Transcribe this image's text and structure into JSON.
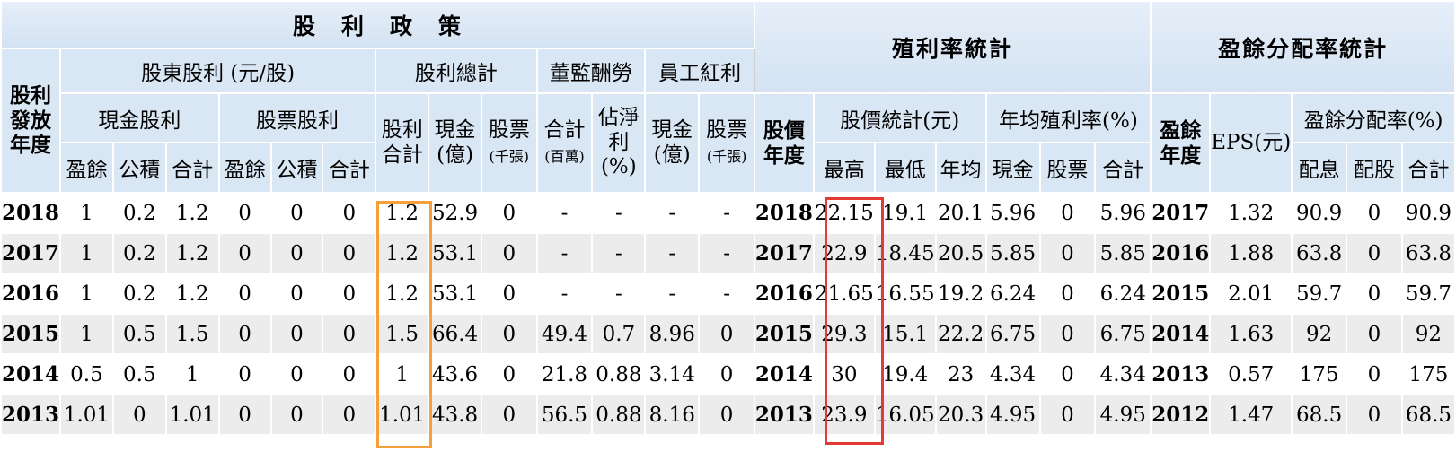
{
  "headers": {
    "dividend_policy": "股　利　政　策",
    "yield_stats": "殖利率統計",
    "payout_stats": "盈餘分配率統計",
    "dividend_year": "股利發放年度",
    "shareholder_dividend": "股東股利 (元/股)",
    "total_dividend": "股利總計",
    "director_comp": "董監酬勞",
    "employee_bonus": "員工紅利",
    "cash_dividend": "現金股利",
    "stock_dividend": "股票股利",
    "dividend_sum": "股利合計",
    "cash_100m": "現金(億)",
    "stock": "股票",
    "stock_unit": "(千張)",
    "total": "合計",
    "million_unit": "(百萬)",
    "est_net_profit": "佔淨利(%)",
    "emp_cash": "現金(億)",
    "emp_stock": "股票",
    "emp_stock_unit": "(千張)",
    "earnings": "盈餘",
    "capital_reserve": "公積",
    "subtotal": "合計",
    "price_year": "股價年度",
    "price_stats": "股價統計(元)",
    "avg_yield": "年均殖利率(%)",
    "high": "最高",
    "low": "最低",
    "avg": "年均",
    "cash": "現金",
    "stock_short": "股票",
    "sum": "合計",
    "earnings_year": "盈餘年度",
    "eps": "EPS(元)",
    "payout_ratio": "盈餘分配率(%)",
    "cash_payout": "配息",
    "stock_payout": "配股",
    "payout_total": "合計"
  },
  "rows": [
    {
      "year": "2018",
      "c_earn": "1",
      "c_res": "0.2",
      "c_tot": "1.2",
      "s_earn": "0",
      "s_res": "0",
      "s_tot": "0",
      "div_tot": "1.2",
      "cash_amt": "52.9",
      "stock_amt": "0",
      "dir_tot": "-",
      "dir_pct": "-",
      "emp_cash": "-",
      "emp_stock": "-",
      "p_year": "2018",
      "high": "22.15",
      "low": "19.1",
      "avg": "20.1",
      "y_cash": "5.96",
      "y_stock": "0",
      "y_tot": "5.96",
      "e_year": "2017",
      "eps": "1.32",
      "r_cash": "90.9",
      "r_stock": "0",
      "r_tot": "90.9"
    },
    {
      "year": "2017",
      "c_earn": "1",
      "c_res": "0.2",
      "c_tot": "1.2",
      "s_earn": "0",
      "s_res": "0",
      "s_tot": "0",
      "div_tot": "1.2",
      "cash_amt": "53.1",
      "stock_amt": "0",
      "dir_tot": "-",
      "dir_pct": "-",
      "emp_cash": "-",
      "emp_stock": "-",
      "p_year": "2017",
      "high": "22.9",
      "low": "18.45",
      "avg": "20.5",
      "y_cash": "5.85",
      "y_stock": "0",
      "y_tot": "5.85",
      "e_year": "2016",
      "eps": "1.88",
      "r_cash": "63.8",
      "r_stock": "0",
      "r_tot": "63.8"
    },
    {
      "year": "2016",
      "c_earn": "1",
      "c_res": "0.2",
      "c_tot": "1.2",
      "s_earn": "0",
      "s_res": "0",
      "s_tot": "0",
      "div_tot": "1.2",
      "cash_amt": "53.1",
      "stock_amt": "0",
      "dir_tot": "-",
      "dir_pct": "-",
      "emp_cash": "-",
      "emp_stock": "-",
      "p_year": "2016",
      "high": "21.65",
      "low": "16.55",
      "avg": "19.2",
      "y_cash": "6.24",
      "y_stock": "0",
      "y_tot": "6.24",
      "e_year": "2015",
      "eps": "2.01",
      "r_cash": "59.7",
      "r_stock": "0",
      "r_tot": "59.7"
    },
    {
      "year": "2015",
      "c_earn": "1",
      "c_res": "0.5",
      "c_tot": "1.5",
      "s_earn": "0",
      "s_res": "0",
      "s_tot": "0",
      "div_tot": "1.5",
      "cash_amt": "66.4",
      "stock_amt": "0",
      "dir_tot": "49.4",
      "dir_pct": "0.7",
      "emp_cash": "8.96",
      "emp_stock": "0",
      "p_year": "2015",
      "high": "29.3",
      "low": "15.1",
      "avg": "22.2",
      "y_cash": "6.75",
      "y_stock": "0",
      "y_tot": "6.75",
      "e_year": "2014",
      "eps": "1.63",
      "r_cash": "92",
      "r_stock": "0",
      "r_tot": "92"
    },
    {
      "year": "2014",
      "c_earn": "0.5",
      "c_res": "0.5",
      "c_tot": "1",
      "s_earn": "0",
      "s_res": "0",
      "s_tot": "0",
      "div_tot": "1",
      "cash_amt": "43.6",
      "stock_amt": "0",
      "dir_tot": "21.8",
      "dir_pct": "0.88",
      "emp_cash": "3.14",
      "emp_stock": "0",
      "p_year": "2014",
      "high": "30",
      "low": "19.4",
      "avg": "23",
      "y_cash": "4.34",
      "y_stock": "0",
      "y_tot": "4.34",
      "e_year": "2013",
      "eps": "0.57",
      "r_cash": "175",
      "r_stock": "0",
      "r_tot": "175"
    },
    {
      "year": "2013",
      "c_earn": "1.01",
      "c_res": "0",
      "c_tot": "1.01",
      "s_earn": "0",
      "s_res": "0",
      "s_tot": "0",
      "div_tot": "1.01",
      "cash_amt": "43.8",
      "stock_amt": "0",
      "dir_tot": "56.5",
      "dir_pct": "0.88",
      "emp_cash": "8.16",
      "emp_stock": "0",
      "p_year": "2013",
      "high": "23.9",
      "low": "16.05",
      "avg": "20.3",
      "y_cash": "4.95",
      "y_stock": "0",
      "y_tot": "4.95",
      "e_year": "2012",
      "eps": "1.47",
      "r_cash": "68.5",
      "r_stock": "0",
      "r_tot": "68.5"
    }
  ],
  "colors": {
    "header_bg": "#d9e6f4",
    "row_alt_bg": "#ececec",
    "highlight_dividend_total": "#f5a03a",
    "highlight_price_high": "#e53935"
  }
}
